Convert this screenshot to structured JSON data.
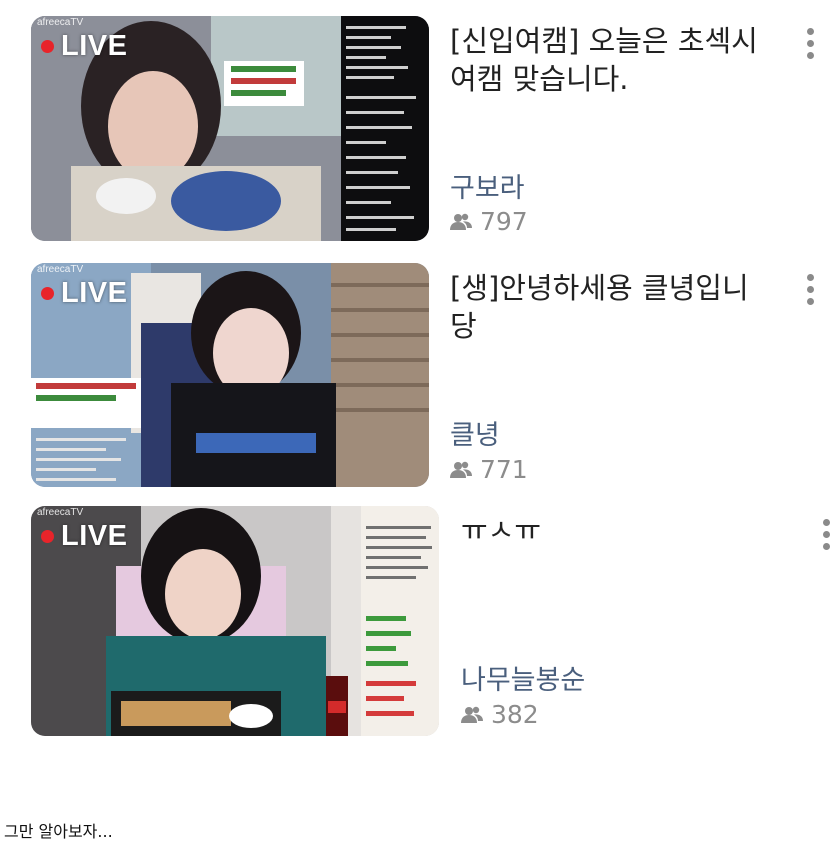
{
  "streams": [
    {
      "live_label": "LIVE",
      "brand": "afreecaTV",
      "title": "[신입여캠] 오늘은 초섹시 여캠 맞습니다.",
      "streamer": "구보라",
      "viewers": "797"
    },
    {
      "live_label": "LIVE",
      "brand": "afreecaTV",
      "title": "[생]안녕하세용 클녕입니당",
      "streamer": "클녕",
      "viewers": "771"
    },
    {
      "live_label": "LIVE",
      "brand": "afreecaTV",
      "title": "ㅠㅅㅠ",
      "streamer": "나무늘봉순",
      "viewers": "382"
    }
  ],
  "caption": "그만 알아보자...",
  "colors": {
    "live_dot": "#e8242a",
    "streamer": "#4a5f7d",
    "viewers": "#8c8c8c",
    "menu_dots": "#8a8a8a"
  },
  "icons": {
    "viewers": "people-icon",
    "menu": "more-vertical-icon"
  }
}
